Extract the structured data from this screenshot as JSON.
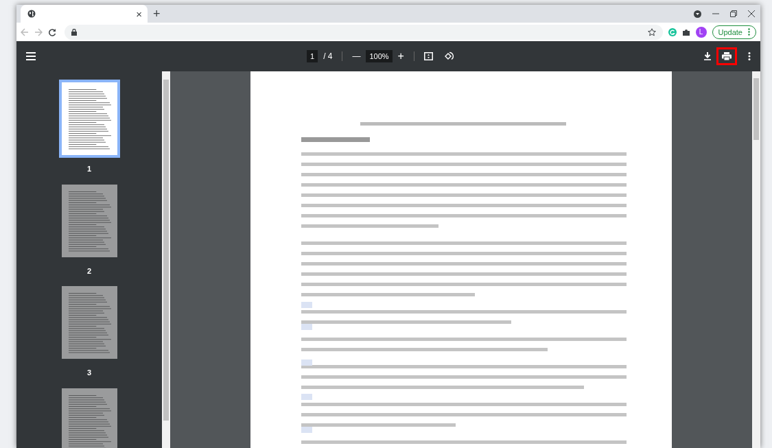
{
  "browser": {
    "tab": {
      "close": "×",
      "selected": true
    },
    "new_tab": "+",
    "avatar": "L",
    "update_button": "Update"
  },
  "pdf_toolbar": {
    "page_input": "1",
    "page_total": "/ 4",
    "zoom": "100%",
    "zoom_out": "—",
    "zoom_in": "+",
    "print_highlighted": true
  },
  "thumbnails": [
    {
      "label": "1",
      "selected": true
    },
    {
      "label": "2",
      "selected": false
    },
    {
      "label": "3",
      "selected": false
    },
    {
      "selected": false
    }
  ]
}
